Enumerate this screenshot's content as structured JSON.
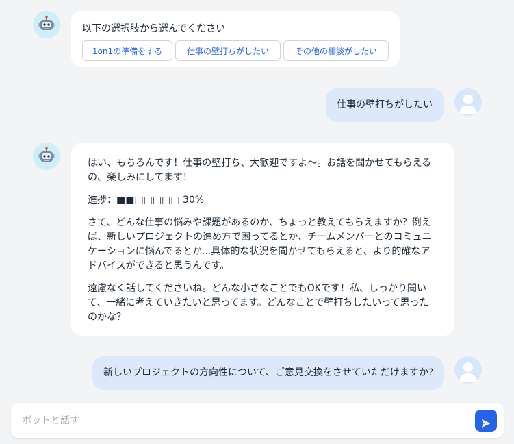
{
  "colors": {
    "accent": "#2563eb",
    "bot_avatar_bg": "#cdeff5",
    "user_bubble": "#dde9fb",
    "background": "#f3f4f6"
  },
  "messages": [
    {
      "role": "bot",
      "avatar_icon": "robot-icon",
      "prompt": "以下の選択肢から選んでください",
      "options": [
        "1on1の準備をする",
        "仕事の壁打ちがしたい",
        "その他の相談がしたい"
      ]
    },
    {
      "role": "user",
      "avatar_icon": "user-icon",
      "text": "仕事の壁打ちがしたい"
    },
    {
      "role": "bot",
      "avatar_icon": "robot-icon",
      "paragraphs": [
        "はい、もちろんです！仕事の壁打ち、大歓迎ですよ〜。お話を聞かせてもらえるの、楽しみにしてます！",
        "進捗：■■□□□□□ 30%",
        "さて、どんな仕事の悩みや課題があるのか、ちょっと教えてもらえますか？例えば、新しいプロジェクトの進め方で困ってるとか、チームメンバーとのコミュニケーションに悩んでるとか...具体的な状況を聞かせてもらえると、より的確なアドバイスができると思うんです。",
        "遠慮なく話してくださいね。どんな小さなことでもOKです！私、しっかり聞いて、一緒に考えていきたいと思ってます。どんなことで壁打ちしたいって思ったのかな？"
      ]
    },
    {
      "role": "user",
      "avatar_icon": "user-icon",
      "text": "新しいプロジェクトの方向性について、ご意見交換をさせていただけますか?"
    }
  ],
  "composer": {
    "placeholder": "ボットと話す",
    "value": "",
    "send_icon": "send-icon"
  }
}
